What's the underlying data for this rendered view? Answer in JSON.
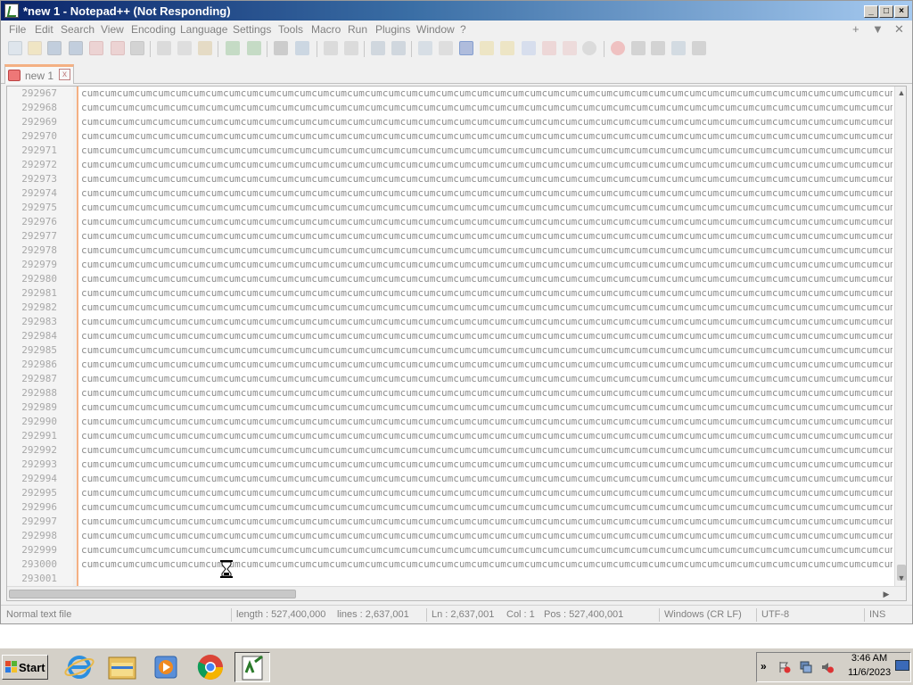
{
  "window": {
    "title": "*new 1 - Notepad++ (Not Responding)",
    "controls": {
      "minimize": "_",
      "maximize": "□",
      "close": "×"
    }
  },
  "menu": {
    "items": [
      "File",
      "Edit",
      "Search",
      "View",
      "Encoding",
      "Language",
      "Settings",
      "Tools",
      "Macro",
      "Run",
      "Plugins",
      "Window",
      "?"
    ],
    "right": [
      "+",
      "▼",
      "✕"
    ]
  },
  "tab": {
    "label": "new 1",
    "close": "x"
  },
  "editor": {
    "line_numbers": [
      "292967",
      "292968",
      "292969",
      "292970",
      "292971",
      "292972",
      "292973",
      "292974",
      "292975",
      "292976",
      "292977",
      "292978",
      "292979",
      "292980",
      "292981",
      "292982",
      "292983",
      "292984",
      "292985",
      "292986",
      "292987",
      "292988",
      "292989",
      "292990",
      "292991",
      "292992",
      "292993",
      "292994",
      "292995",
      "292996",
      "292997",
      "292998",
      "292999",
      "293000",
      "293001"
    ],
    "line_text": "cumcumcumcumcumcumcumcumcumcumcumcumcumcumcumcumcumcumcumcumcumcumcumcumcumcumcumcumcumcumcumcumcumcumcumcumcumcumcumcumcumcumcumcumcumcumcumcum",
    "last_line_text": ""
  },
  "status": {
    "file_type": "Normal text file",
    "length": "length : 527,400,000",
    "lines": "lines : 2,637,001",
    "ln": "Ln : 2,637,001",
    "col": "Col : 1",
    "pos": "Pos : 527,400,001",
    "eol": "Windows (CR LF)",
    "encoding": "UTF-8",
    "mode": "INS"
  },
  "taskbar": {
    "start_label": "Start",
    "clock_time": "3:46 AM",
    "clock_date": "11/6/2023",
    "tray_expand": "»"
  },
  "colors": {
    "title_gradient_start": "#0a246a",
    "title_gradient_end": "#a6caf0",
    "tab_accent": "#f4b083",
    "disabled_text": "#808080"
  }
}
